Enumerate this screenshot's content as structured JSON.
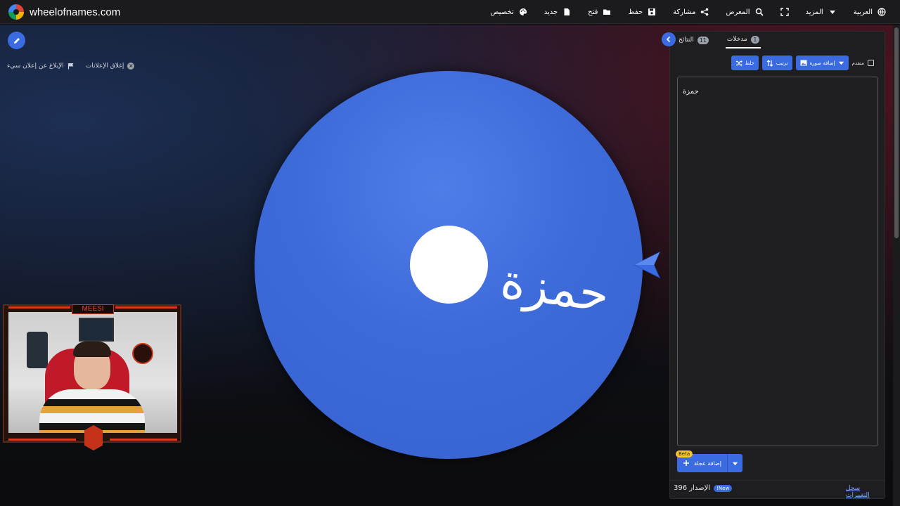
{
  "brand": {
    "name": "wheelofnames.com"
  },
  "menu": {
    "items": [
      {
        "label": "العربية",
        "icon": "globe-icon"
      },
      {
        "label": "المزيد",
        "icon": "caret-down-icon"
      },
      {
        "label": "",
        "icon": "fullscreen-icon"
      },
      {
        "label": "المعرض",
        "icon": "search-icon"
      },
      {
        "label": "مشاركة",
        "icon": "share-icon"
      },
      {
        "label": "حفظ",
        "icon": "save-icon"
      },
      {
        "label": "فتح",
        "icon": "folder-icon"
      },
      {
        "label": "جديد",
        "icon": "file-icon"
      },
      {
        "label": "تخصيص",
        "icon": "palette-icon"
      }
    ]
  },
  "ads": {
    "close_label": "إغلاق الإعلانات",
    "report_label": "الإبلاغ عن إعلان سيء"
  },
  "wheel": {
    "segment_label": "حمزة",
    "color": "#3d6ad9"
  },
  "webcam": {
    "title": "MEESI"
  },
  "panel": {
    "tabs": [
      {
        "label": "مدخلات",
        "count": "1",
        "active": true
      },
      {
        "label": "النتائج",
        "count": "11",
        "active": false
      }
    ],
    "toolbar": {
      "shuffle": "خلط",
      "sort": "ترتيب",
      "add_image": "إضافة صورة",
      "advanced": "متقدم"
    },
    "entries_text": "حمزة",
    "add_wheel": {
      "label": "إضافة عجلة",
      "beta": "Beta"
    },
    "footer": {
      "changelog": "سجل التغييرات",
      "version_label": "الإصدار 396",
      "new_badge": "New!"
    }
  },
  "colors": {
    "accent": "#3a6be0",
    "panel_bg": "#1e1e21",
    "topbar_bg": "#1b1b1e"
  }
}
